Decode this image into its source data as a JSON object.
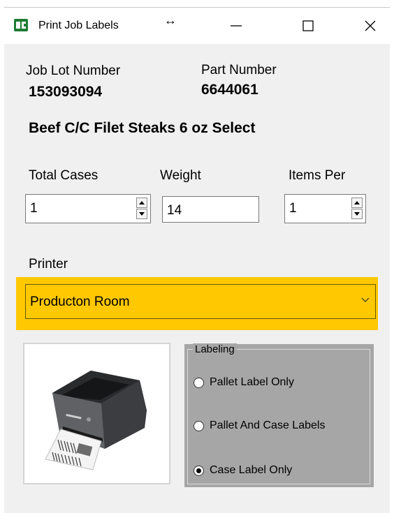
{
  "window": {
    "title": "Print Job Labels",
    "resize_glyph": "↔"
  },
  "job": {
    "lot_label": "Job Lot Number",
    "lot_value": "153093094",
    "part_label": "Part Number",
    "part_value": "6644061",
    "description": "Beef C/C Filet Steaks 6 oz Select"
  },
  "fields": {
    "total_cases_label": "Total Cases",
    "total_cases_value": "1",
    "weight_label": "Weight",
    "weight_value": "14",
    "items_per_label": "Items Per",
    "items_per_value": "1"
  },
  "printer": {
    "label": "Printer",
    "selected": "Producton Room",
    "highlight_color": "#ffc800"
  },
  "labeling": {
    "legend": "Labeling",
    "options": [
      {
        "label": "Pallet Label Only",
        "checked": false
      },
      {
        "label": "Pallet And Case Labels",
        "checked": false
      },
      {
        "label": "Case Label Only",
        "checked": true
      }
    ]
  },
  "icons": {
    "app": "app-icon-green",
    "image": "printer-image"
  }
}
